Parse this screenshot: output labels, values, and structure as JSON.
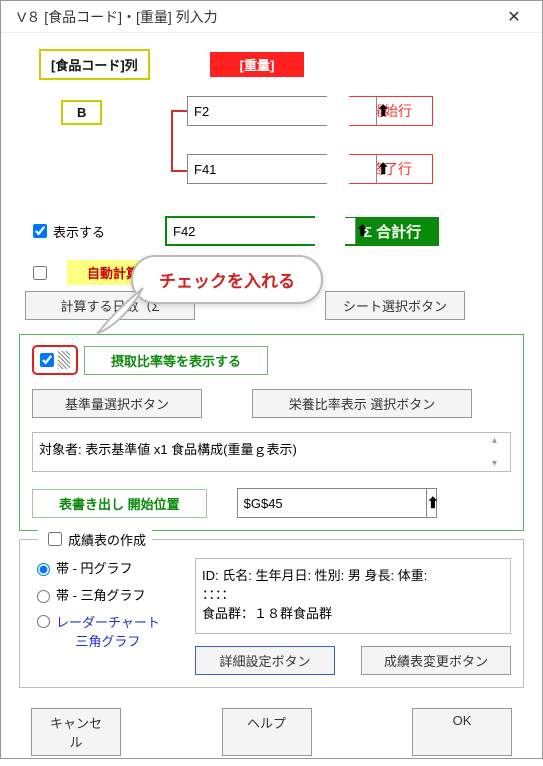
{
  "window": {
    "title": "V８ [食品コード]・[重量] 列入力"
  },
  "header": {
    "food_code_col_label": "[食品コード]列",
    "weight_label": "[重量]"
  },
  "column_letter": "B",
  "start_row": {
    "value": "F2",
    "btn": "開始行"
  },
  "end_row": {
    "value": "F41",
    "btn": "終了行"
  },
  "sum_row": {
    "value": "F42",
    "label": "Σ 合計行"
  },
  "display_checkbox_label": "表示する",
  "auto_calc_strip": "自動計算式を組み込む",
  "calc_days_btn": "計算する日数（Σ",
  "sheet_select_btn": "シート選択ボタン",
  "ratio_checkbox_label": "摂取比率等を表示する",
  "standard_btn": "基準量選択ボタン",
  "nutri_ratio_btn": "栄養比率表示 選択ボタン",
  "target_text": "対象者: 表示基準値 x1  食品構成(重量ｇ表示)",
  "export_label": "表書き出し 開始位置",
  "export_cell": "$G$45",
  "report": {
    "title": "成績表の作成",
    "radio1": "帯 - 円グラフ",
    "radio2": "帯 - 三角グラフ",
    "radio3a": "レーダーチャート",
    "radio3b": "三角グラフ",
    "preview_line1": "ID:  氏名:  生年月日:  性別: 男 身長:  体重:",
    "preview_line2": "：：：：",
    "preview_line3": "食品群：１８群食品群",
    "detail_btn": "詳細設定ボタン",
    "change_btn": "成績表変更ボタン"
  },
  "footer": {
    "cancel": "キャンセル",
    "help": "ヘルプ",
    "ok": "OK"
  },
  "callout": "チェックを入れる"
}
